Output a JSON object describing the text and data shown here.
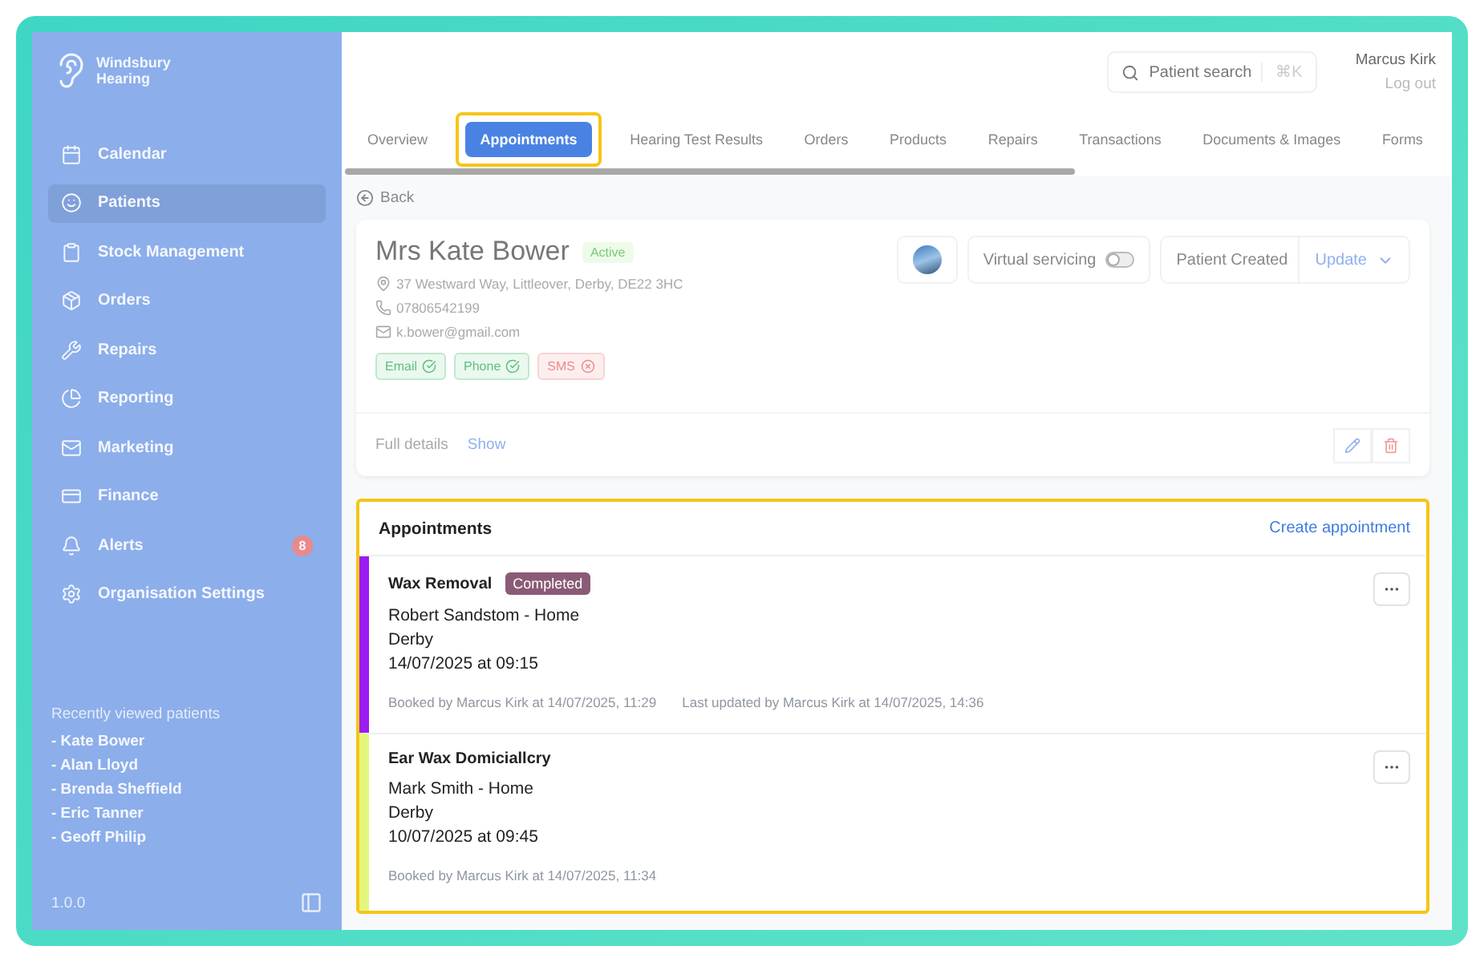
{
  "brand": {
    "line_1": "Windsbury",
    "line_2": "Hearing"
  },
  "sidebar": {
    "items": [
      {
        "kind": "calendar",
        "label": "Calendar",
        "selected": false
      },
      {
        "kind": "patients",
        "label": "Patients",
        "selected": true
      },
      {
        "kind": "stock",
        "label": "Stock Management",
        "selected": false
      },
      {
        "kind": "orders",
        "label": "Orders",
        "selected": false
      },
      {
        "kind": "repairs",
        "label": "Repairs",
        "selected": false
      },
      {
        "kind": "reporting",
        "label": "Reporting",
        "selected": false
      },
      {
        "kind": "marketing",
        "label": "Marketing",
        "selected": false
      },
      {
        "kind": "finance",
        "label": "Finance",
        "selected": false
      },
      {
        "kind": "alerts",
        "label": "Alerts",
        "selected": false,
        "badge": "8"
      },
      {
        "kind": "settings",
        "label": "Organisation Settings",
        "selected": false
      }
    ],
    "recent": {
      "title": "Recently viewed patients",
      "patients": [
        "- Kate Bower",
        "- Alan Lloyd",
        "- Brenda Sheffield",
        "- Eric Tanner",
        "- Geoff Philip"
      ]
    },
    "version": "1.0.0"
  },
  "header": {
    "search": {
      "placeholder": "Patient search",
      "shortcut": "⌘K"
    },
    "user": "Marcus Kirk",
    "logout": "Log out"
  },
  "tabs": [
    {
      "label": "Overview",
      "selected": false,
      "highlighted": false
    },
    {
      "label": "Appointments",
      "selected": true,
      "highlighted": true
    },
    {
      "label": "Hearing Test Results",
      "selected": false,
      "highlighted": false
    },
    {
      "label": "Orders",
      "selected": false,
      "highlighted": false
    },
    {
      "label": "Products",
      "selected": false,
      "highlighted": false
    },
    {
      "label": "Repairs",
      "selected": false,
      "highlighted": false
    },
    {
      "label": "Transactions",
      "selected": false,
      "highlighted": false
    },
    {
      "label": "Documents & Images",
      "selected": false,
      "highlighted": false
    },
    {
      "label": "Forms",
      "selected": false,
      "highlighted": false
    }
  ],
  "back": "Back",
  "patient": {
    "name": "Mrs Kate Bower",
    "status": "Active",
    "address": "37 Westward Way, Littleover, Derby, DE22 3HC",
    "phone": "07806542199",
    "email": "k.bower@gmail.com",
    "consents": [
      {
        "label": "Email",
        "ok": true
      },
      {
        "label": "Phone",
        "ok": true
      },
      {
        "label": "SMS",
        "ok": false
      }
    ],
    "virtual_servicing": {
      "label": "Virtual servicing",
      "on": false
    },
    "created": "Patient Created",
    "update": "Update",
    "full_details": "Full details",
    "show": "Show"
  },
  "appointments": {
    "title": "Appointments",
    "create": "Create appointment",
    "highlighted": true,
    "items": [
      {
        "title": "Wax Removal",
        "status": "Completed",
        "clinician": "Robert Sandstom - Home",
        "city": "Derby",
        "datetime": "14/07/2025 at 09:15",
        "booked": "Booked by Marcus Kirk at 14/07/2025, 11:29",
        "updated": "Last updated by Marcus Kirk at 14/07/2025, 14:36",
        "color": "#9b1cf2"
      },
      {
        "title": "Ear Wax Domiciallcry",
        "clinician": "Mark Smith - Home",
        "city": "Derby",
        "datetime": "10/07/2025 at 09:45",
        "booked": "Booked by Marcus Kirk at 14/07/2025, 11:34",
        "color": "#e4f77c"
      }
    ]
  }
}
